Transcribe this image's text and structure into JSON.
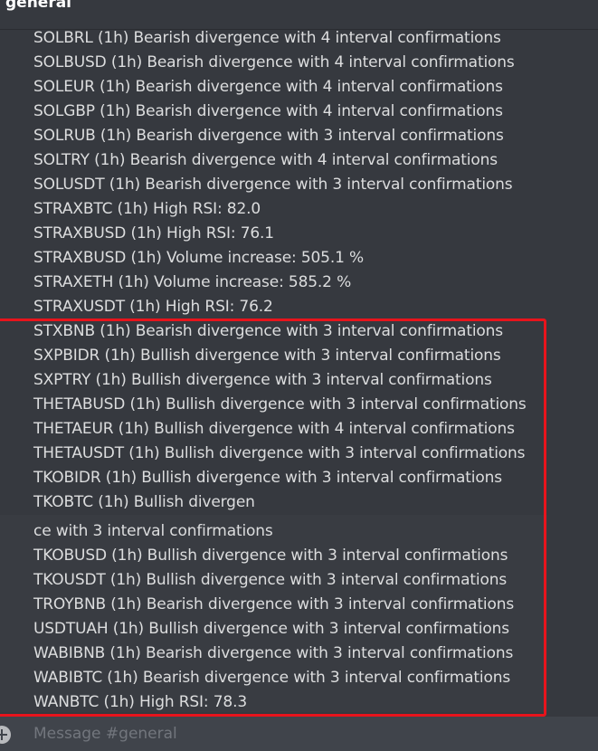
{
  "channel": {
    "name": "general"
  },
  "messages": [
    "SOLBRL (1h) Bearish divergence with 4 interval confirmations",
    "SOLBUSD (1h) Bearish divergence with 4 interval confirmations",
    "SOLEUR (1h) Bearish divergence with 4 interval confirmations",
    "SOLGBP (1h) Bearish divergence with 4 interval confirmations",
    "SOLRUB (1h) Bearish divergence with 3 interval confirmations",
    "SOLTRY (1h) Bearish divergence with 4 interval confirmations",
    "SOLUSDT (1h) Bearish divergence with 3 interval confirmations",
    "STRAXBTC (1h) High RSI: 82.0",
    "STRAXBUSD (1h) High RSI: 76.1",
    "STRAXBUSD (1h) Volume increase: 505.1 %",
    "STRAXETH (1h) Volume increase: 585.2 %",
    "STRAXUSDT (1h) High RSI: 76.2",
    "STXBNB (1h) Bearish divergence with 3 interval confirmations",
    "SXPBIDR (1h) Bullish divergence with 3 interval confirmations",
    "SXPTRY (1h) Bullish divergence with 3 interval confirmations",
    "THETABUSD (1h) Bullish divergence with 3 interval confirmations",
    "THETAEUR (1h) Bullish divergence with 4 interval confirmations",
    "THETAUSDT (1h) Bullish divergence with 3 interval confirmations",
    "TKOBIDR (1h) Bullish divergence with 3 interval confirmations",
    "TKOBTC (1h) Bullish divergen",
    "ce with 3 interval confirmations",
    "TKOBUSD (1h) Bullish divergence with 3 interval confirmations",
    "TKOUSDT (1h) Bullish divergence with 3 interval confirmations",
    "TROYBNB (1h) Bearish divergence with 3 interval confirmations",
    "USDTUAH (1h) Bullish divergence with 3 interval confirmations",
    "WABIBNB (1h) Bearish divergence with 3 interval confirmations",
    "WABIBTC (1h) Bearish divergence with 3 interval confirmations",
    "WANBTC (1h) High RSI: 78.3"
  ],
  "composer": {
    "placeholder": "Message #general"
  },
  "colors": {
    "background": "#36393f",
    "text": "#dcddde",
    "highlight": "#e8141c"
  },
  "icons": {
    "add": "plus-circle-icon"
  }
}
